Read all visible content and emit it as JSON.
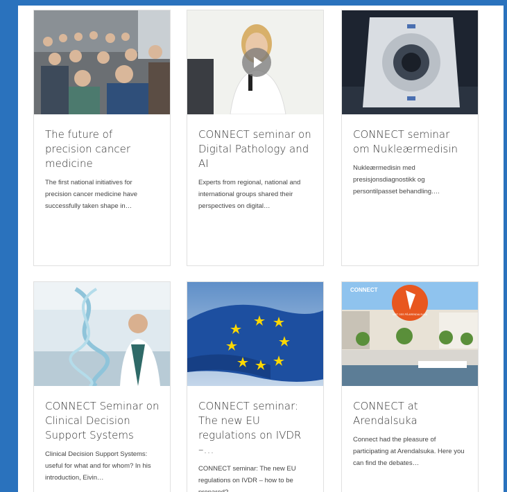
{
  "cards": [
    {
      "title": "The future of precision cancer medicine",
      "desc": "The first national initiatives for precision cancer medicine have successfully taken shape in…"
    },
    {
      "title": "CONNECT seminar on Digital Pathology and AI",
      "desc": "Experts from regional, national and international groups shared their perspectives on digital…"
    },
    {
      "title": "CONNECT seminar om Nukleærmedisin",
      "desc": "Nukleærmedisin med presisjonsdiagnostikk og persontilpasset behandling.…"
    },
    {
      "title": "CONNECT Seminar on Clinical Decision Support Systems",
      "desc": "Clinical Decision Support Systems: useful for what and for whom? In his introduction, Eivin…"
    },
    {
      "title": "CONNECT seminar: The new EU regulations on IVDR –…",
      "desc": "CONNECT seminar: The new EU regulations on IVDR – how to be prepared?"
    },
    {
      "title": "CONNECT at Arendalsuka",
      "desc": "Connect had the pleasure of participating at Arendalsuka. Here you can find the debates…"
    }
  ],
  "thumb_text": {
    "connect_logo": "CONNECT",
    "badge": "MØT OSS PÅ ARENDALSUKA"
  },
  "colors": {
    "page_bg": "#2a72bd",
    "card_border": "#e0e0e0",
    "title_text": "#333333",
    "eu_blue": "#1d4fa0",
    "eu_star": "#ffd800",
    "badge_orange": "#e8571f"
  },
  "icons": {
    "video_play": "play-icon"
  }
}
